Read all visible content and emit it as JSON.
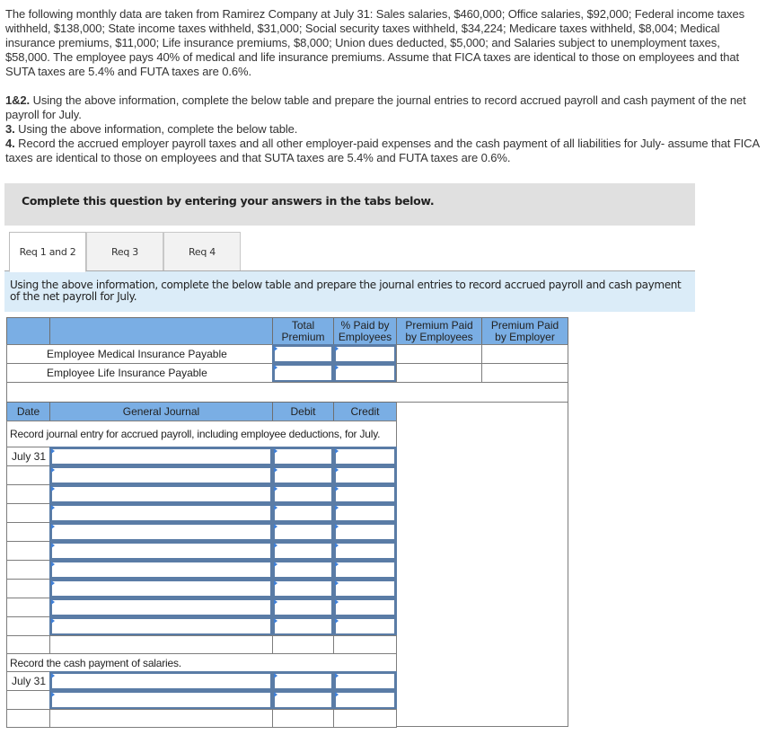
{
  "problem": {
    "text": "The following monthly data are taken from Ramirez Company at July 31: Sales salaries, $460,000; Office salaries, $92,000; Federal income taxes withheld, $138,000; State income taxes withheld, $31,000; Social security taxes withheld, $34,224; Medicare taxes withheld, $8,004; Medical insurance premiums, $11,000; Life insurance premiums, $8,000; Union dues deducted, $5,000; and Salaries subject to unemployment taxes, $58,000. The employee pays 40% of medical and life insurance premiums. Assume that FICA taxes are identical to those on employees and that SUTA taxes are 5.4% and FUTA taxes are 0.6%."
  },
  "requirements": [
    {
      "num": "1&2.",
      "text": " Using the above information, complete the below table and prepare the journal entries to record accrued payroll and cash payment of the net payroll for July."
    },
    {
      "num": "3.",
      "text": " Using the above information, complete the below table."
    },
    {
      "num": "4.",
      "text": " Record the accrued employer payroll taxes and all other employer-paid expenses and the cash payment of all liabilities for July- assume that FICA taxes are identical to those on employees and that SUTA taxes are 5.4% and FUTA taxes are 0.6%."
    }
  ],
  "banner": "Complete this question by entering your answers in the tabs below.",
  "tabs": [
    {
      "label": "Req 1 and 2",
      "active": true
    },
    {
      "label": "Req 3",
      "active": false
    },
    {
      "label": "Req 4",
      "active": false
    }
  ],
  "instruction": "Using the above information, complete the below table and prepare the journal entries to record accrued payroll and cash payment of the net payroll for July.",
  "premium_table": {
    "headers": [
      "",
      "Total Premium",
      "% Paid by Employees",
      "Premium Paid by Employees",
      "Premium Paid by Employer"
    ],
    "rows": [
      {
        "label": "Employee Medical Insurance Payable",
        "total_premium": "",
        "pct_paid": "",
        "paid_by_employees": "",
        "paid_by_employer": ""
      },
      {
        "label": "Employee Life Insurance Payable",
        "total_premium": "",
        "pct_paid": "",
        "paid_by_employees": "",
        "paid_by_employer": ""
      }
    ]
  },
  "journal": {
    "headers": {
      "date": "Date",
      "account": "General Journal",
      "debit": "Debit",
      "credit": "Credit"
    },
    "sections": [
      {
        "note": "Record journal entry for accrued payroll, including employee deductions, for July.",
        "date": "July 31",
        "input_rows": 10
      },
      {
        "note": "Record the cash payment of salaries.",
        "date": "July 31",
        "input_rows": 2
      }
    ]
  }
}
